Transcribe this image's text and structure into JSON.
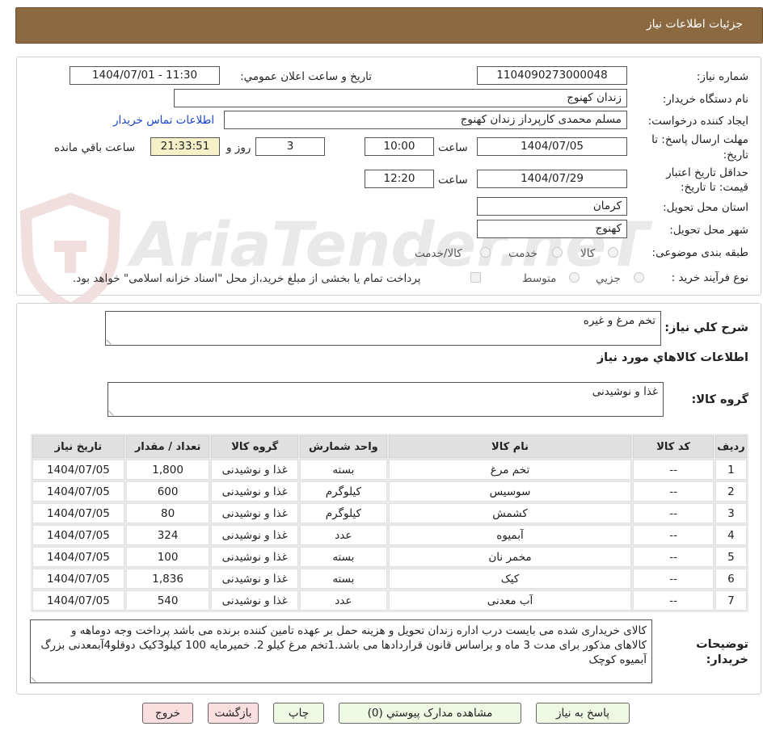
{
  "header": {
    "title": "جزئیات اطلاعات نیاز"
  },
  "watermark": {
    "text": "AriaTender.neT"
  },
  "form": {
    "need_number_label": "شماره نیاز:",
    "need_number": "1104090273000048",
    "announce_label": "تاریخ و ساعت اعلان عمومي:",
    "announce_value": "1404/07/01 - 11:30",
    "buyer_org_label": "نام دستگاه خریدار:",
    "buyer_org": "زندان کهنوج",
    "requester_label": "ایجاد کننده درخواست:",
    "requester": "مسلم محمدی کارپرداز زندان کهنوج",
    "contact_link": "اطلاعات تماس خریدار",
    "deadline_label_1": "مهلت ارسال پاسخ: تا",
    "deadline_label_2": "تاریخ:",
    "deadline_date": "1404/07/05",
    "time_label": "ساعت",
    "deadline_time": "10:00",
    "days_value": "3",
    "days_label": "روز و",
    "remaining_time": "21:33:51",
    "remaining_label": "ساعت باقي مانده",
    "validity_label_1": "حداقل تاریخ اعتبار",
    "validity_label_2": "قیمت: تا تاریخ:",
    "validity_date": "1404/07/29",
    "validity_time": "12:20",
    "province_label": "استان محل تحویل:",
    "province": "کرمان",
    "city_label": "شهر محل تحویل:",
    "city": "کهنوج",
    "category_label": "طبقه بندی موضوعی:",
    "category_options": [
      "کالا",
      "خدمت",
      "کالا/خدمت"
    ],
    "process_label": "نوع فرآیند خرید :",
    "process_options": [
      "جزیي",
      "متوسط"
    ],
    "payment_note": "پرداخت تمام یا بخشی از مبلغ خرید،از محل \"اسناد خزانه اسلامی\" خواهد بود."
  },
  "details": {
    "summary_label": "شرح کلي نیاز:",
    "summary": "تخم مرغ و غیره",
    "goods_info_title": "اطلاعات کالاهاي مورد نیاز",
    "goods_group_label": "گروه کالا:",
    "goods_group": "غذا و نوشیدنی"
  },
  "table": {
    "headers": [
      "ردیف",
      "کد کالا",
      "نام کالا",
      "واحد شمارش",
      "گروه کالا",
      "تعداد / مقدار",
      "تاریخ نیاز"
    ],
    "rows": [
      [
        "1",
        "--",
        "تخم مرغ",
        "بسته",
        "غذا و نوشیدنی",
        "1,800",
        "1404/07/05"
      ],
      [
        "2",
        "--",
        "سوسیس",
        "کیلوگرم",
        "غذا و نوشیدنی",
        "600",
        "1404/07/05"
      ],
      [
        "3",
        "--",
        "کشمش",
        "کیلوگرم",
        "غذا و نوشیدنی",
        "80",
        "1404/07/05"
      ],
      [
        "4",
        "--",
        "آبمیوه",
        "عدد",
        "غذا و نوشیدنی",
        "324",
        "1404/07/05"
      ],
      [
        "5",
        "--",
        "مخمر نان",
        "بسته",
        "غذا و نوشیدنی",
        "100",
        "1404/07/05"
      ],
      [
        "6",
        "--",
        "کیک",
        "بسته",
        "غذا و نوشیدنی",
        "1,836",
        "1404/07/05"
      ],
      [
        "7",
        "--",
        "آب معدنی",
        "عدد",
        "غذا و نوشیدنی",
        "540",
        "1404/07/05"
      ]
    ]
  },
  "buyer_notes": {
    "label_1": "توضیحات",
    "label_2": "خریدار:",
    "text": "کالای خریداری شده می بایست درب اداره زندان تحویل و هزینه حمل بر عهده تامین کننده برنده می باشد پرداخت وجه دوماهه و کالاهای مذکور برای مدت 3 ماه و براساس قانون قراردادها می باشد.1تخم مرغ کیلو 2. خمیرمایه 100 کیلو3کیک دوقلو4آبمعدنی بزرگ آبمیوه کوچک"
  },
  "buttons": {
    "reply": "پاسخ به نیاز",
    "attachments": "مشاهده مدارک پیوستي (0)",
    "print": "چاپ",
    "back": "بازگشت",
    "exit": "خروج"
  }
}
